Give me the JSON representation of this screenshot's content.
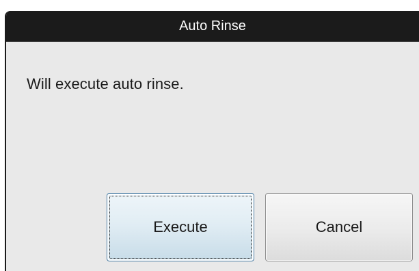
{
  "dialog": {
    "title": "Auto Rinse",
    "message": "Will execute auto rinse."
  },
  "buttons": {
    "execute_label": "Execute",
    "cancel_label": "Cancel"
  },
  "colors": {
    "titlebar": "#1b1b1b",
    "dialog_background": "#e9e9e9",
    "focused_button_border": "#4a7da4"
  }
}
